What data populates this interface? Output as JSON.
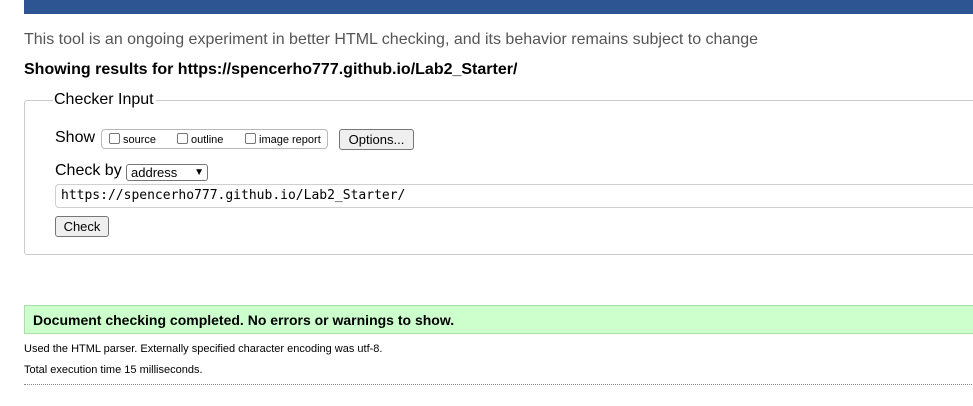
{
  "intro_text": "This tool is an ongoing experiment in better HTML checking, and its behavior remains subject to change",
  "results_heading": "Showing results for https://spencerho777.github.io/Lab2_Starter/",
  "checker": {
    "legend": "Checker Input",
    "show_label": "Show",
    "options": [
      {
        "label": "source",
        "checked": false
      },
      {
        "label": "outline",
        "checked": false
      },
      {
        "label": "image report",
        "checked": false
      }
    ],
    "options_button": "Options...",
    "check_by_label": "Check by",
    "check_by_value": "address",
    "url_value": "https://spencerho777.github.io/Lab2_Starter/",
    "check_button": "Check"
  },
  "result": {
    "message": "Document checking completed. No errors or warnings to show.",
    "parser_info": "Used the HTML parser. Externally specified character encoding was utf-8.",
    "execution_time": "Total execution time 15 milliseconds."
  },
  "colors": {
    "top_bar": "#2c5591",
    "success_bg": "#ccffcc"
  }
}
